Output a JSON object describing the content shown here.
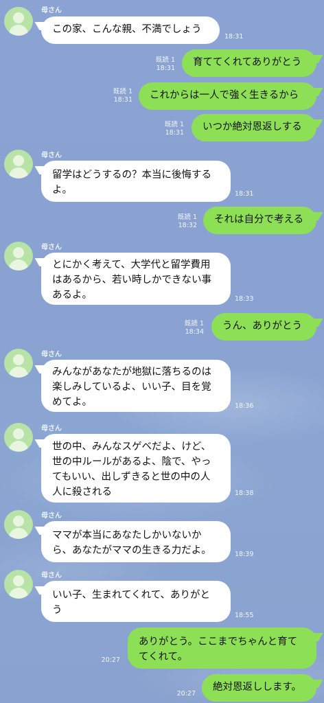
{
  "chat": {
    "sender_name": "母さん",
    "messages": [
      {
        "from": "other",
        "lines": [
          "この家、こんな親、不満でしょう"
        ],
        "time": "18:31"
      },
      {
        "from": "me",
        "lines": [
          "育ててくれてありがとう"
        ],
        "read": "既読 1",
        "time": "18:31"
      },
      {
        "from": "me",
        "lines": [
          "これからは一人で強く生きるから"
        ],
        "read": "既読 1",
        "time": "18:31"
      },
      {
        "from": "me",
        "lines": [
          "いつか絶対恩返しする"
        ],
        "read": "既読 1",
        "time": "18:31"
      },
      {
        "from": "other",
        "lines": [
          "留学はどうするの？本当に後悔する",
          "よ。"
        ],
        "time": "18:31"
      },
      {
        "from": "me",
        "lines": [
          "それは自分で考える"
        ],
        "read": "既読 1",
        "time": "18:32"
      },
      {
        "from": "other",
        "lines": [
          "とにかく考えて、大学代と留学費用",
          "はあるから、若い時しかできない事",
          "あるよ。"
        ],
        "time": "18:33"
      },
      {
        "from": "me",
        "lines": [
          "うん、ありがとう"
        ],
        "read": "既読 1",
        "time": "18:34"
      },
      {
        "from": "other",
        "lines": [
          "みんながあなたが地獄に落ちるのは",
          "楽しみしているよ、いい子、目を覚",
          "めてよ。"
        ],
        "time": "18:36"
      },
      {
        "from": "other",
        "lines": [
          "世の中、みんなスゲベだよ、けど、",
          "世の中ルールがあるよ、陰で、やっ",
          "てもいい、出しずきると世の中の人",
          "人に殺される"
        ],
        "time": "18:38"
      },
      {
        "from": "other",
        "lines": [
          "ママが本当にあなたしかいないか",
          "ら、あなたがママの生きる力だよ。"
        ],
        "time": "18:39"
      },
      {
        "from": "other",
        "lines": [
          "いい子、生まれてくれて、ありがと",
          "う"
        ],
        "time": "18:55"
      },
      {
        "from": "me",
        "lines": [
          "ありがとう。ここまでちゃんと育て",
          "てくれて。"
        ],
        "time": "20:27"
      },
      {
        "from": "me",
        "lines": [
          "絶対恩返しします。"
        ],
        "time": "20:27"
      }
    ]
  }
}
